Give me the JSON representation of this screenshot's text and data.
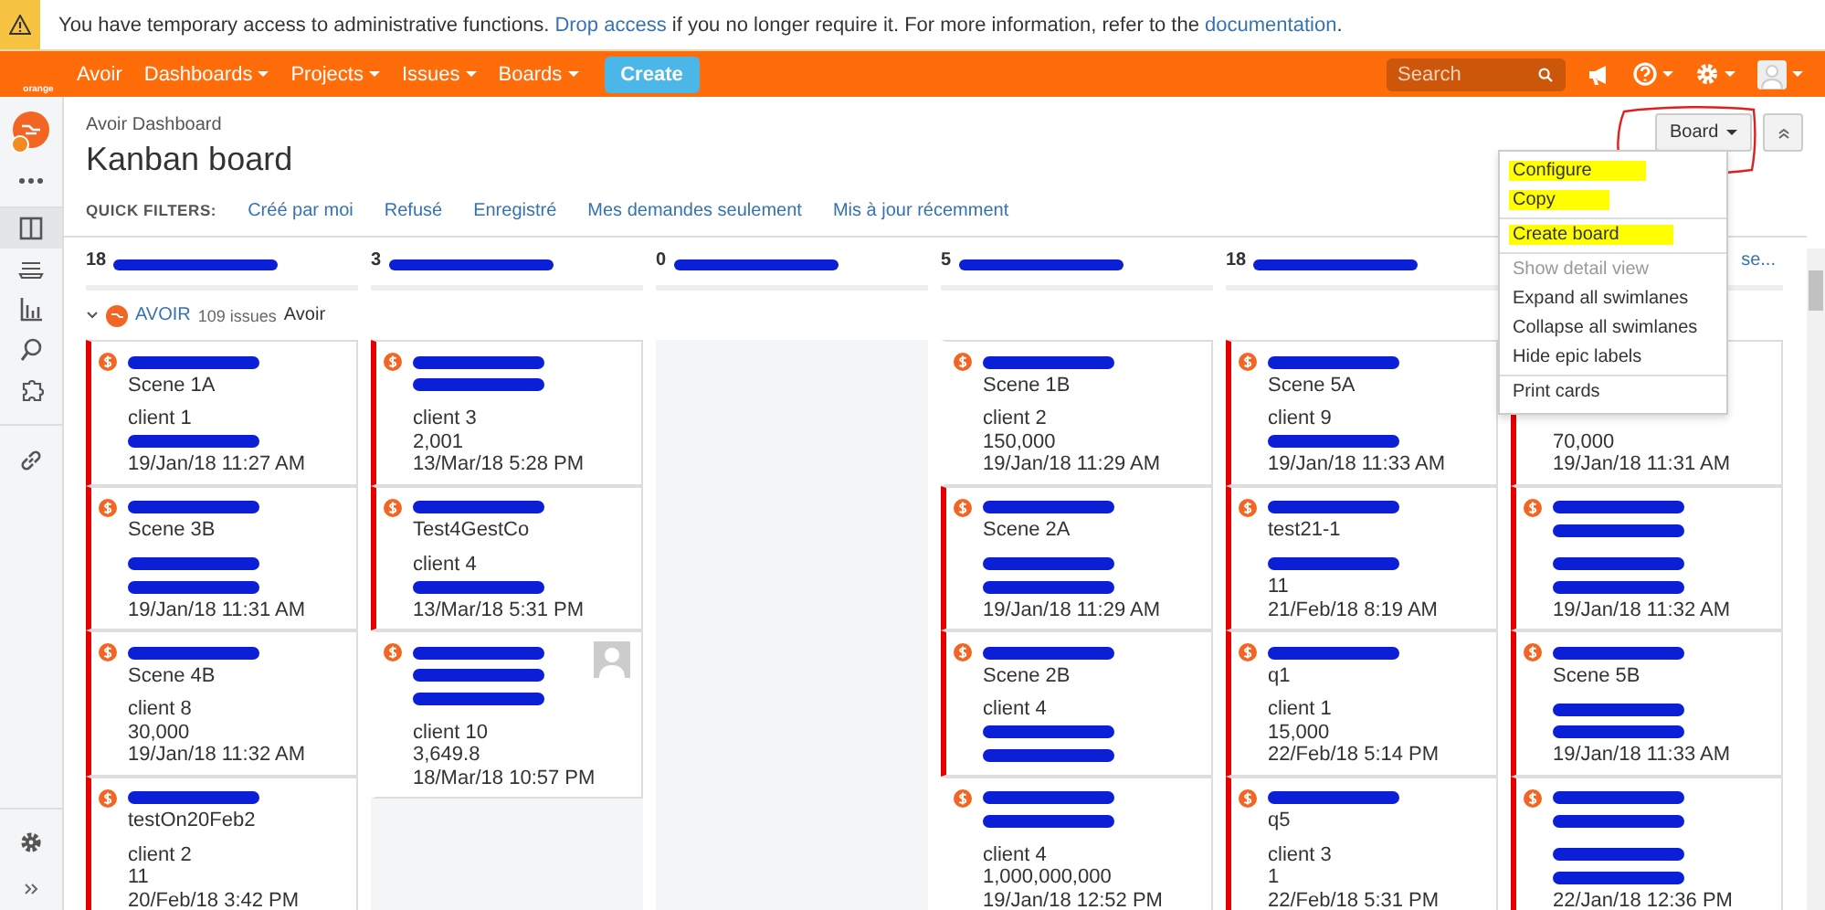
{
  "banner": {
    "parts": [
      {
        "kind": "text",
        "text": "You have temporary access to administrative functions. "
      },
      {
        "kind": "link",
        "text": "Drop access"
      },
      {
        "kind": "text",
        "text": " if you no longer require it. For more information, refer to the "
      },
      {
        "kind": "link",
        "text": "documentation"
      },
      {
        "kind": "text",
        "text": "."
      }
    ]
  },
  "nav": {
    "logo": "orange",
    "items": [
      {
        "label": "Avoir",
        "dropdown": false
      },
      {
        "label": "Dashboards",
        "dropdown": true
      },
      {
        "label": "Projects",
        "dropdown": true
      },
      {
        "label": "Issues",
        "dropdown": true
      },
      {
        "label": "Boards",
        "dropdown": true
      }
    ],
    "create": "Create",
    "search": {
      "placeholder": "Search"
    }
  },
  "sidebar": {
    "items": [
      {
        "selected": true
      },
      {
        "selected": false
      },
      {
        "selected": false
      },
      {
        "selected": false
      },
      {
        "selected": false
      },
      {
        "selected": false
      }
    ]
  },
  "header": {
    "breadcrumb": "Avoir Dashboard",
    "title": "Kanban board",
    "quick_filters_label": "QUICK FILTERS:",
    "quick_filters": [
      "Créé par moi",
      "Refusé",
      "Enregistré",
      "Mes demandes seulement",
      "Mis à jour récemment"
    ],
    "board_button": "Board"
  },
  "menu": {
    "groups": [
      [
        {
          "label": "Configure",
          "highlighted": true,
          "disabled": false
        },
        {
          "label": "Copy",
          "highlighted": true,
          "disabled": false
        }
      ],
      [
        {
          "label": "Create board",
          "highlighted": true,
          "disabled": false
        }
      ],
      [
        {
          "label": "Show detail view",
          "highlighted": false,
          "disabled": true
        },
        {
          "label": "Expand all swimlanes",
          "highlighted": false,
          "disabled": false
        },
        {
          "label": "Collapse all swimlanes",
          "highlighted": false,
          "disabled": false
        },
        {
          "label": "Hide epic labels",
          "highlighted": false,
          "disabled": false
        }
      ],
      [
        {
          "label": "Print cards",
          "highlighted": false,
          "disabled": false
        }
      ]
    ]
  },
  "swimlane": {
    "key": "AVOIR",
    "count": "109 issues",
    "name": "Avoir",
    "expanded": true
  },
  "columns": [
    {
      "count": "18",
      "title_redacted": true,
      "cards": [
        {
          "flagged": true,
          "head": [
            {
              "kind": "redacted"
            },
            {
              "kind": "text",
              "text": "Scene 1A"
            }
          ],
          "body": [
            {
              "kind": "text",
              "text": "client 1"
            },
            {
              "kind": "redacted"
            },
            {
              "kind": "text",
              "text": "19/Jan/18 11:27 AM"
            }
          ]
        },
        {
          "flagged": true,
          "head": [
            {
              "kind": "redacted"
            },
            {
              "kind": "text",
              "text": "Scene 3B"
            }
          ],
          "body": [
            {
              "kind": "redacted"
            },
            {
              "kind": "redacted"
            },
            {
              "kind": "text",
              "text": "19/Jan/18 11:31 AM"
            }
          ]
        },
        {
          "flagged": true,
          "head": [
            {
              "kind": "redacted"
            },
            {
              "kind": "text",
              "text": "Scene 4B"
            }
          ],
          "body": [
            {
              "kind": "text",
              "text": "client 8"
            },
            {
              "kind": "text",
              "text": "30,000"
            },
            {
              "kind": "text",
              "text": "19/Jan/18 11:32 AM"
            }
          ]
        },
        {
          "flagged": true,
          "head": [
            {
              "kind": "redacted"
            },
            {
              "kind": "text",
              "text": "testOn20Feb2"
            }
          ],
          "body": [
            {
              "kind": "text",
              "text": "client 2"
            },
            {
              "kind": "text",
              "text": "11"
            },
            {
              "kind": "text",
              "text": "20/Feb/18 3:42 PM"
            }
          ]
        }
      ]
    },
    {
      "count": "3",
      "title_redacted": true,
      "cards": [
        {
          "flagged": true,
          "head": [
            {
              "kind": "redacted"
            },
            {
              "kind": "redacted"
            }
          ],
          "body": [
            {
              "kind": "text",
              "text": "client 3"
            },
            {
              "kind": "text",
              "text": "2,001"
            },
            {
              "kind": "text",
              "text": "13/Mar/18 5:28 PM"
            }
          ]
        },
        {
          "flagged": true,
          "head": [
            {
              "kind": "redacted"
            },
            {
              "kind": "text",
              "text": "Test4GestCo"
            }
          ],
          "body": [
            {
              "kind": "text",
              "text": "client 4"
            },
            {
              "kind": "redacted"
            },
            {
              "kind": "text",
              "text": "13/Mar/18 5:31 PM"
            }
          ]
        },
        {
          "flagged": false,
          "avatar": true,
          "head": [
            {
              "kind": "redacted"
            },
            {
              "kind": "redacted"
            },
            {
              "kind": "redacted"
            }
          ],
          "body": [
            {
              "kind": "text",
              "text": "client 10"
            },
            {
              "kind": "text",
              "text": "3,649.8"
            },
            {
              "kind": "text",
              "text": "18/Mar/18 10:57 PM"
            }
          ]
        }
      ]
    },
    {
      "count": "0",
      "title_redacted": true
    },
    {
      "count": "5",
      "title_redacted": true,
      "cards": [
        {
          "flagged": false,
          "head": [
            {
              "kind": "redacted"
            },
            {
              "kind": "text",
              "text": "Scene 1B"
            }
          ],
          "body": [
            {
              "kind": "text",
              "text": "client 2"
            },
            {
              "kind": "text",
              "text": "150,000"
            },
            {
              "kind": "text",
              "text": "19/Jan/18 11:29 AM"
            }
          ]
        },
        {
          "flagged": true,
          "head": [
            {
              "kind": "redacted"
            },
            {
              "kind": "text",
              "text": "Scene 2A"
            }
          ],
          "body": [
            {
              "kind": "redacted"
            },
            {
              "kind": "redacted"
            },
            {
              "kind": "text",
              "text": "19/Jan/18 11:29 AM"
            }
          ]
        },
        {
          "flagged": true,
          "head": [
            {
              "kind": "redacted"
            },
            {
              "kind": "text",
              "text": "Scene 2B"
            }
          ],
          "body": [
            {
              "kind": "text",
              "text": "client 4"
            },
            {
              "kind": "redacted"
            },
            {
              "kind": "redacted"
            }
          ]
        },
        {
          "flagged": false,
          "head": [
            {
              "kind": "redacted"
            },
            {
              "kind": "redacted"
            }
          ],
          "body": [
            {
              "kind": "text",
              "text": "client 4"
            },
            {
              "kind": "text",
              "text": "1,000,000,000"
            },
            {
              "kind": "text",
              "text": "19/Jan/18 12:52 PM"
            }
          ]
        }
      ]
    },
    {
      "count": "18",
      "title_redacted": true,
      "cards": [
        {
          "flagged": true,
          "head": [
            {
              "kind": "redacted"
            },
            {
              "kind": "text",
              "text": "Scene 5A"
            }
          ],
          "body": [
            {
              "kind": "text",
              "text": "client 9"
            },
            {
              "kind": "redacted"
            },
            {
              "kind": "text",
              "text": "19/Jan/18 11:33 AM"
            }
          ]
        },
        {
          "flagged": true,
          "head": [
            {
              "kind": "redacted"
            },
            {
              "kind": "text",
              "text": "test21-1"
            }
          ],
          "body": [
            {
              "kind": "redacted"
            },
            {
              "kind": "text",
              "text": "11"
            },
            {
              "kind": "text",
              "text": "21/Feb/18 8:19 AM"
            }
          ]
        },
        {
          "flagged": true,
          "head": [
            {
              "kind": "redacted"
            },
            {
              "kind": "text",
              "text": "q1"
            }
          ],
          "body": [
            {
              "kind": "text",
              "text": "client 1"
            },
            {
              "kind": "text",
              "text": "15,000"
            },
            {
              "kind": "text",
              "text": "22/Feb/18 5:14 PM"
            }
          ]
        },
        {
          "flagged": true,
          "head": [
            {
              "kind": "redacted"
            },
            {
              "kind": "text",
              "text": "q5"
            }
          ],
          "body": [
            {
              "kind": "text",
              "text": "client 3"
            },
            {
              "kind": "text",
              "text": "1"
            },
            {
              "kind": "text",
              "text": "22/Feb/18 5:31 PM"
            }
          ]
        }
      ]
    },
    {
      "link": "se...",
      "cards": [
        {
          "flagged": true,
          "head": [
            {
              "kind": "hidden"
            },
            {
              "kind": "hidden"
            }
          ],
          "body": [
            {
              "kind": "hidden"
            },
            {
              "kind": "text",
              "text": "70,000"
            },
            {
              "kind": "text",
              "text": "19/Jan/18 11:31 AM"
            }
          ]
        },
        {
          "flagged": true,
          "head": [
            {
              "kind": "redacted"
            },
            {
              "kind": "redacted"
            }
          ],
          "body": [
            {
              "kind": "redacted"
            },
            {
              "kind": "redacted"
            },
            {
              "kind": "text",
              "text": "19/Jan/18 11:32 AM"
            }
          ]
        },
        {
          "flagged": true,
          "head": [
            {
              "kind": "redacted"
            },
            {
              "kind": "text",
              "text": "Scene 5B"
            }
          ],
          "body": [
            {
              "kind": "redacted"
            },
            {
              "kind": "redacted"
            },
            {
              "kind": "text",
              "text": "19/Jan/18 11:33 AM"
            }
          ]
        },
        {
          "flagged": true,
          "head": [
            {
              "kind": "redacted"
            },
            {
              "kind": "redacted"
            }
          ],
          "body": [
            {
              "kind": "redacted"
            },
            {
              "kind": "redacted"
            },
            {
              "kind": "text",
              "text": "22/Jan/18 12:36 PM"
            }
          ]
        }
      ]
    }
  ]
}
